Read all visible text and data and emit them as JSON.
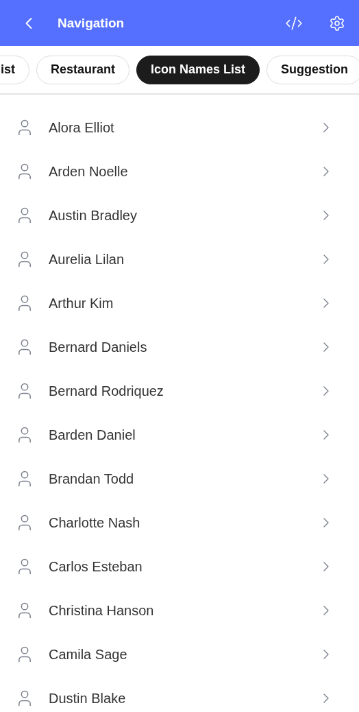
{
  "header": {
    "title": "Navigation"
  },
  "chips": [
    {
      "label": "ist",
      "selected": false
    },
    {
      "label": "Restaurant",
      "selected": false
    },
    {
      "label": "Icon Names List",
      "selected": true
    },
    {
      "label": "Suggestion",
      "selected": false
    }
  ],
  "contacts": [
    {
      "name": "Alora Elliot"
    },
    {
      "name": "Arden Noelle"
    },
    {
      "name": "Austin Bradley"
    },
    {
      "name": "Aurelia Lilan"
    },
    {
      "name": "Arthur Kim"
    },
    {
      "name": "Bernard Daniels"
    },
    {
      "name": "Bernard Rodriquez"
    },
    {
      "name": "Barden Daniel"
    },
    {
      "name": "Brandan Todd"
    },
    {
      "name": "Charlotte Nash"
    },
    {
      "name": "Carlos Esteban"
    },
    {
      "name": "Christina Hanson"
    },
    {
      "name": "Camila Sage"
    },
    {
      "name": "Dustin Blake"
    }
  ]
}
